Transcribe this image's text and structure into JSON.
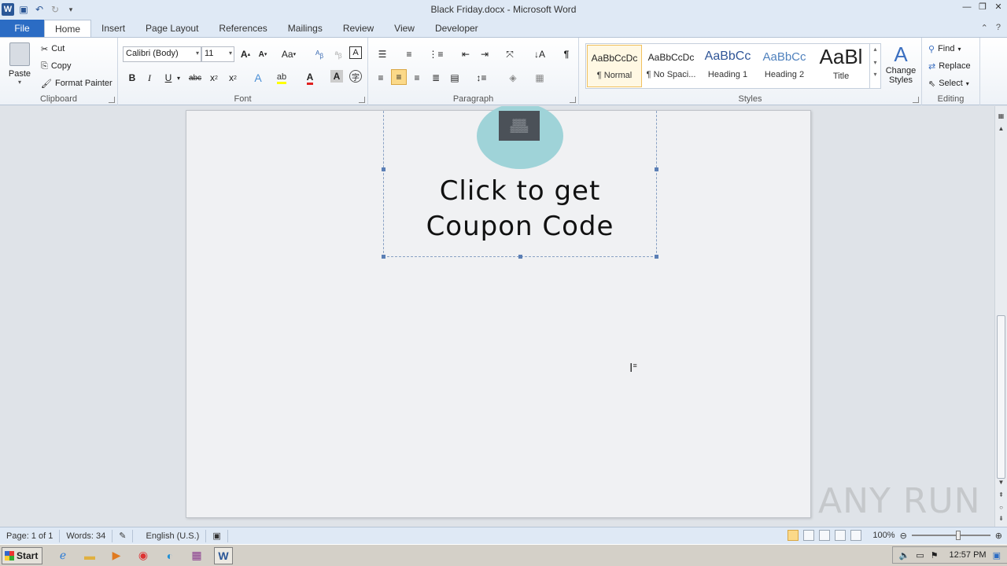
{
  "window": {
    "title": "Black Friday.docx - Microsoft Word"
  },
  "tabs": [
    {
      "label": "File"
    },
    {
      "label": "Home"
    },
    {
      "label": "Insert"
    },
    {
      "label": "Page Layout"
    },
    {
      "label": "References"
    },
    {
      "label": "Mailings"
    },
    {
      "label": "Review"
    },
    {
      "label": "View"
    },
    {
      "label": "Developer"
    }
  ],
  "clipboard": {
    "paste": "Paste",
    "cut": "Cut",
    "copy": "Copy",
    "format_painter": "Format Painter",
    "group": "Clipboard"
  },
  "font": {
    "name": "Calibri (Body)",
    "size": "11",
    "group": "Font",
    "change_case": "Aa"
  },
  "paragraph": {
    "group": "Paragraph"
  },
  "styles": {
    "group": "Styles",
    "items": [
      {
        "sample": "AaBbCcDc",
        "name": "¶ Normal"
      },
      {
        "sample": "AaBbCcDc",
        "name": "¶ No Spaci..."
      },
      {
        "sample": "AaBbCc",
        "name": "Heading 1"
      },
      {
        "sample": "AaBbCc",
        "name": "Heading 2"
      },
      {
        "sample": "AaBl",
        "name": "Title"
      }
    ],
    "change_styles": "Change Styles"
  },
  "editing": {
    "find": "Find",
    "replace": "Replace",
    "select": "Select",
    "group": "Editing"
  },
  "document": {
    "line1": "Click to get",
    "line2": "Coupon Code"
  },
  "statusbar": {
    "page": "Page: 1 of 1",
    "words": "Words: 34",
    "language": "English (U.S.)",
    "zoom": "100%"
  },
  "taskbar": {
    "start": "Start",
    "time": "12:57 PM"
  },
  "watermark": "ANY RUN"
}
